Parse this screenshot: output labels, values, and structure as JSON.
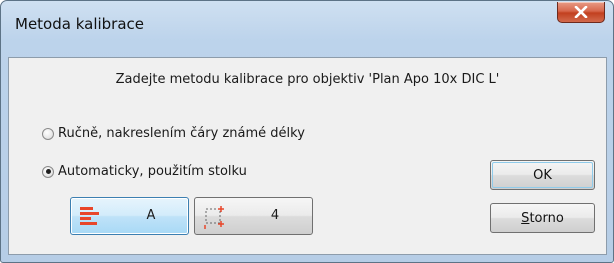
{
  "window": {
    "title": "Metoda kalibrace",
    "close_icon": "close-x-icon"
  },
  "dialog": {
    "prompt": "Zadejte metodu kalibrace pro objektiv 'Plan Apo 10x DIC L'",
    "options": [
      {
        "label": "Ručně, nakreslením čáry známé délky",
        "selected": false
      },
      {
        "label": "Automaticky, použitím stolku",
        "selected": true
      }
    ],
    "tools": [
      {
        "label": "A",
        "icon": "horizontal-bars-icon",
        "active": true
      },
      {
        "label": "4",
        "icon": "dotted-rectangle-icon",
        "active": false
      }
    ],
    "ok_label": "OK",
    "cancel_label_accel": "S",
    "cancel_label_rest": "torno"
  },
  "colors": {
    "accent_red": "#e8462a",
    "accent_blue": "#3c7fb1",
    "close_red": "#c2401f"
  }
}
